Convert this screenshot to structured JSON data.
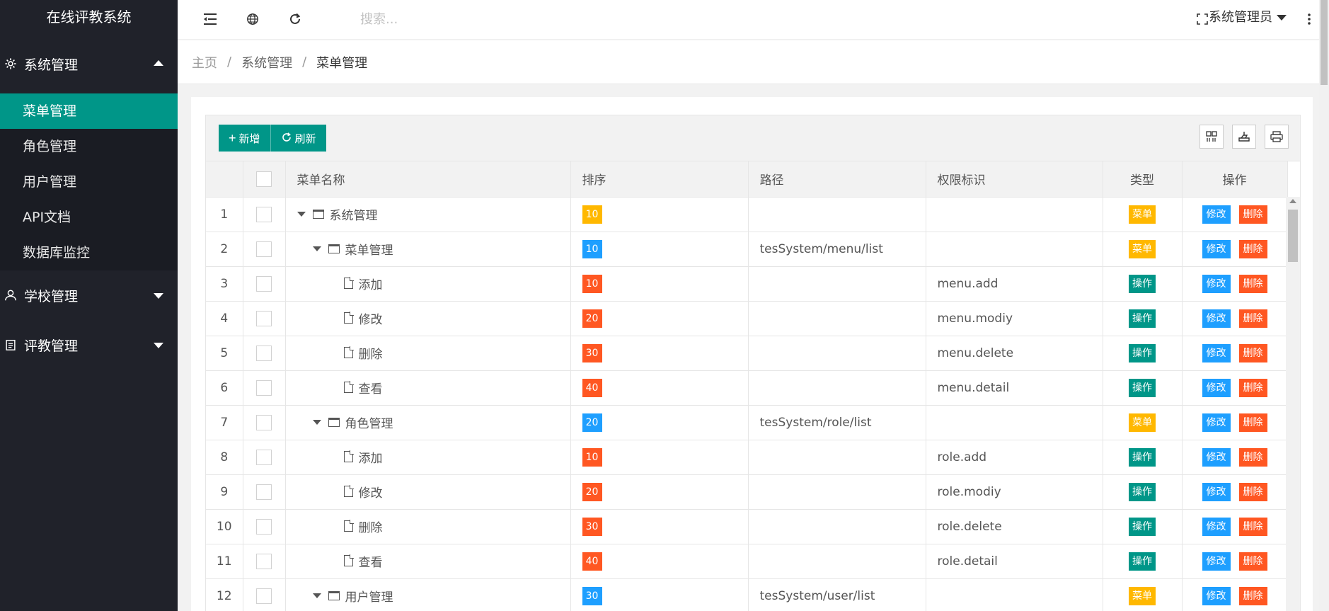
{
  "app": {
    "title": "在线评教系统"
  },
  "sidebar": {
    "groups": [
      {
        "label": "系统管理",
        "items": [
          "菜单管理",
          "角色管理",
          "用户管理",
          "API文档",
          "数据库监控"
        ]
      },
      {
        "label": "学校管理"
      },
      {
        "label": "评教管理"
      }
    ]
  },
  "header": {
    "search_placeholder": "搜索...",
    "user": "系统管理员"
  },
  "breadcrumb": {
    "home": "主页",
    "sep": "/",
    "mid": "系统管理",
    "current": "菜单管理"
  },
  "toolbar": {
    "add_label": "新增",
    "refresh_label": "刷新"
  },
  "table": {
    "columns": [
      "菜单名称",
      "排序",
      "路径",
      "权限标识",
      "类型",
      "操作"
    ],
    "edit_label": "修改",
    "delete_label": "删除",
    "rows": [
      {
        "idx": "1",
        "name": "系统管理",
        "level": 0,
        "kind": "folder",
        "sort": "10",
        "path": "",
        "perm": "",
        "type": "菜单"
      },
      {
        "idx": "2",
        "name": "菜单管理",
        "level": 1,
        "kind": "folder",
        "sort": "10",
        "path": "tesSystem/menu/list",
        "perm": "",
        "type": "菜单"
      },
      {
        "idx": "3",
        "name": "添加",
        "level": 2,
        "kind": "file",
        "sort": "10",
        "path": "",
        "perm": "menu.add",
        "type": "操作"
      },
      {
        "idx": "4",
        "name": "修改",
        "level": 2,
        "kind": "file",
        "sort": "20",
        "path": "",
        "perm": "menu.modiy",
        "type": "操作"
      },
      {
        "idx": "5",
        "name": "删除",
        "level": 2,
        "kind": "file",
        "sort": "30",
        "path": "",
        "perm": "menu.delete",
        "type": "操作"
      },
      {
        "idx": "6",
        "name": "查看",
        "level": 2,
        "kind": "file",
        "sort": "40",
        "path": "",
        "perm": "menu.detail",
        "type": "操作"
      },
      {
        "idx": "7",
        "name": "角色管理",
        "level": 1,
        "kind": "folder",
        "sort": "20",
        "path": "tesSystem/role/list",
        "perm": "",
        "type": "菜单"
      },
      {
        "idx": "8",
        "name": "添加",
        "level": 2,
        "kind": "file",
        "sort": "10",
        "path": "",
        "perm": "role.add",
        "type": "操作"
      },
      {
        "idx": "9",
        "name": "修改",
        "level": 2,
        "kind": "file",
        "sort": "20",
        "path": "",
        "perm": "role.modiy",
        "type": "操作"
      },
      {
        "idx": "10",
        "name": "删除",
        "level": 2,
        "kind": "file",
        "sort": "30",
        "path": "",
        "perm": "role.delete",
        "type": "操作"
      },
      {
        "idx": "11",
        "name": "查看",
        "level": 2,
        "kind": "file",
        "sort": "40",
        "path": "",
        "perm": "role.detail",
        "type": "操作"
      },
      {
        "idx": "12",
        "name": "用户管理",
        "level": 1,
        "kind": "folder",
        "sort": "30",
        "path": "tesSystem/user/list",
        "perm": "",
        "type": "菜单"
      }
    ]
  },
  "colors": {
    "accent": "#009688",
    "sidebar_bg": "#20222a",
    "badge_yellow": "#ffb800",
    "badge_blue": "#1e9fff",
    "badge_red": "#ff5722"
  }
}
